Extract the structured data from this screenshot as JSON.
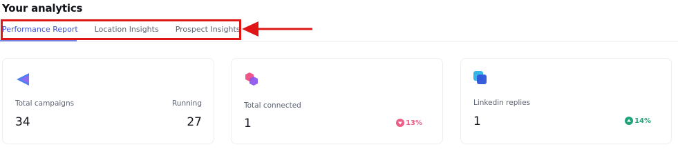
{
  "header": {
    "title": "Your analytics"
  },
  "tabs": [
    {
      "label": "Performance Report",
      "active": true
    },
    {
      "label": "Location Insights",
      "active": false
    },
    {
      "label": "Prospect Insights",
      "active": false
    }
  ],
  "cards": [
    {
      "icon": "campaign-arrow-icon",
      "label": "Total campaigns",
      "value": "34",
      "secondary_label": "Running",
      "secondary_value": "27"
    },
    {
      "icon": "connected-hexagon-icon",
      "label": "Total connected",
      "value": "1",
      "change": "13%",
      "change_direction": "down"
    },
    {
      "icon": "linkedin-replies-icon",
      "label": "Linkedin replies",
      "value": "1",
      "change": "14%",
      "change_direction": "up"
    }
  ],
  "colors": {
    "accent": "#3a50d6",
    "highlight": "#e01515",
    "down": "#ec5e86",
    "up": "#1fa37a"
  }
}
